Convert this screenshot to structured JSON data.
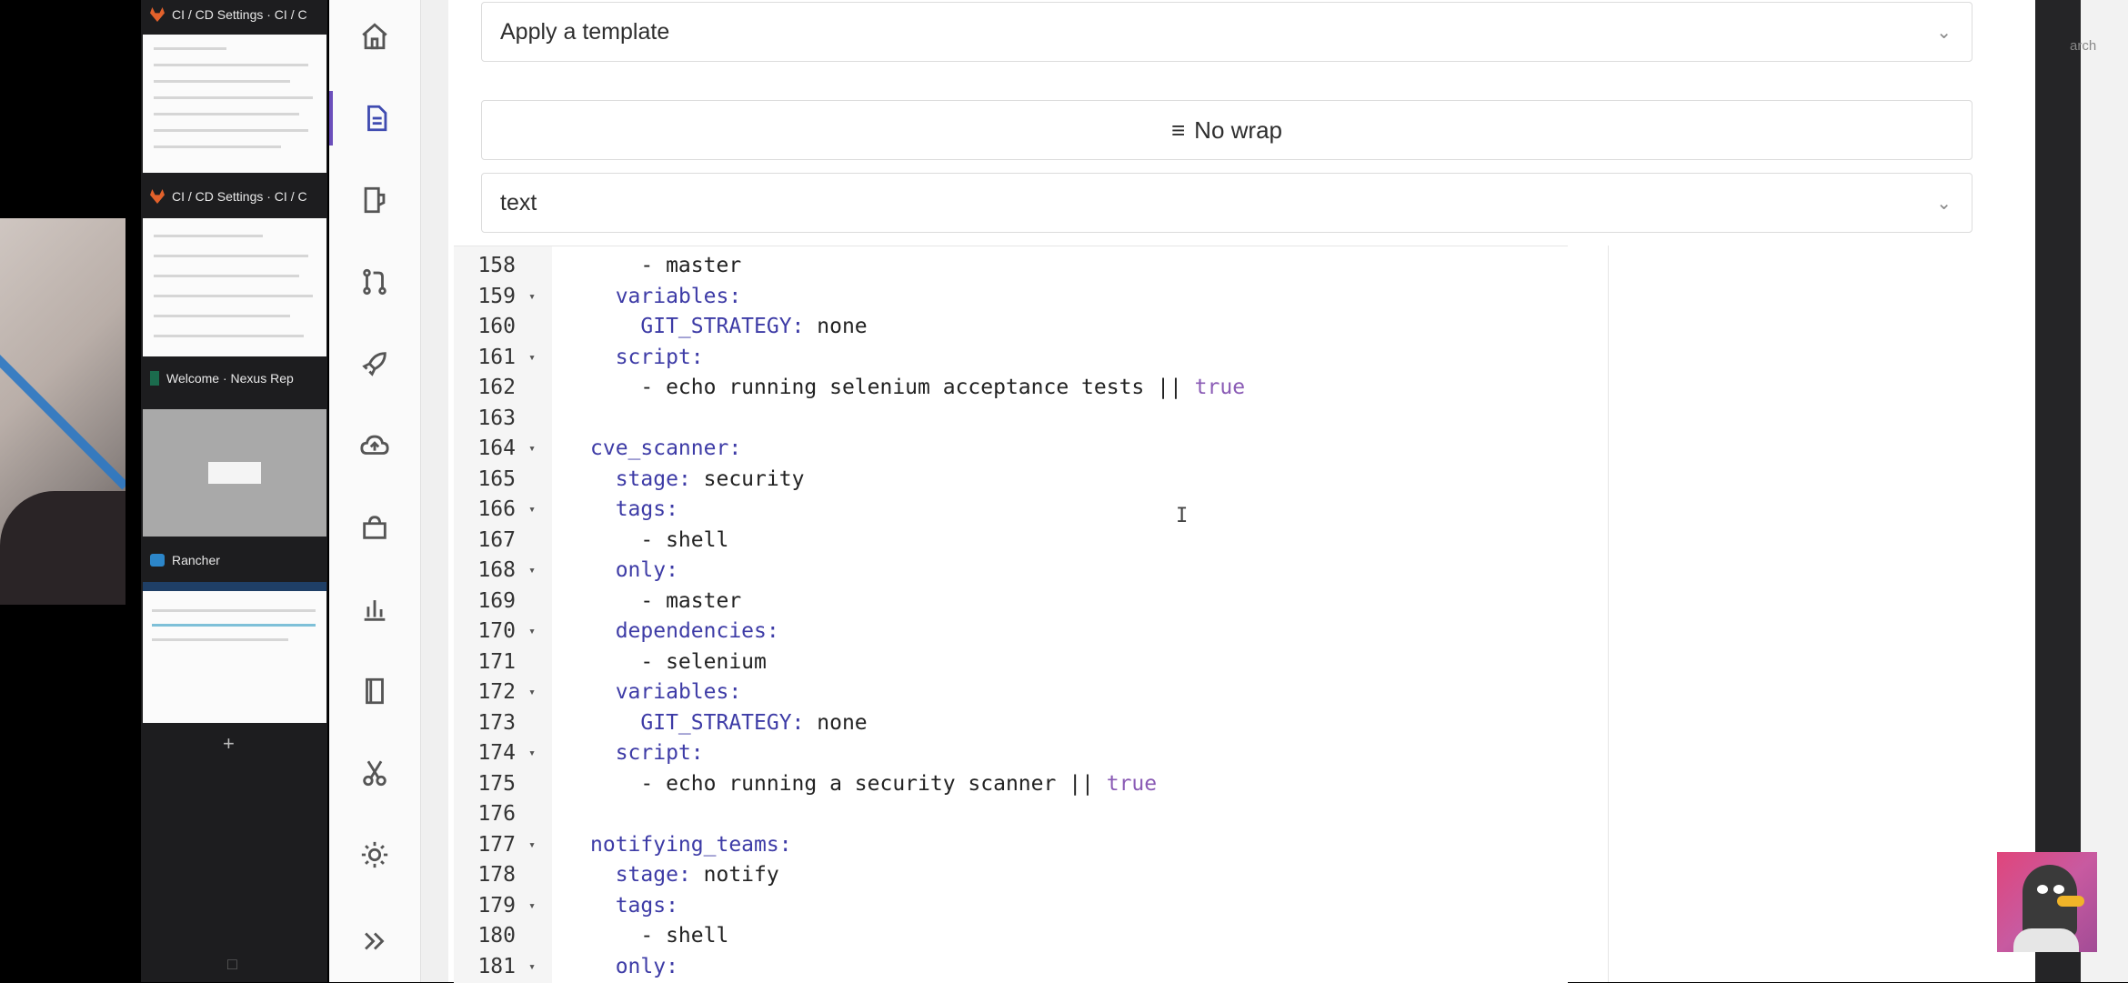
{
  "switcher": {
    "windows": [
      {
        "title": "CI / CD Settings · CI / C",
        "icon": "gitlab-icon"
      },
      {
        "title": "CI / CD Settings · CI / C",
        "icon": "gitlab-icon"
      },
      {
        "title": "Welcome · Nexus Rep",
        "icon": "nexus-icon"
      },
      {
        "title": "Rancher",
        "icon": "rancher-icon"
      }
    ],
    "add_label": "+"
  },
  "sidebar": {
    "items": [
      {
        "name": "home-icon"
      },
      {
        "name": "file-icon",
        "active": true
      },
      {
        "name": "issues-icon"
      },
      {
        "name": "merge-request-icon"
      },
      {
        "name": "rocket-icon"
      },
      {
        "name": "cloud-icon"
      },
      {
        "name": "package-icon"
      },
      {
        "name": "chart-icon"
      },
      {
        "name": "book-icon"
      },
      {
        "name": "scissors-icon"
      },
      {
        "name": "gear-icon"
      },
      {
        "name": "expand-icon"
      }
    ]
  },
  "toolbar": {
    "template_label": "Apply a template",
    "wrap_label": "No wrap",
    "mode_label": "text"
  },
  "editor": {
    "lines": [
      {
        "n": "158",
        "fold": false,
        "text": "    - master"
      },
      {
        "n": "159",
        "fold": true,
        "text": "  variables:"
      },
      {
        "n": "160",
        "fold": false,
        "text": "    GIT_STRATEGY: none"
      },
      {
        "n": "161",
        "fold": true,
        "text": "  script:"
      },
      {
        "n": "162",
        "fold": false,
        "text": "    - echo running selenium acceptance tests || true"
      },
      {
        "n": "163",
        "fold": false,
        "text": ""
      },
      {
        "n": "164",
        "fold": true,
        "text": "cve_scanner:"
      },
      {
        "n": "165",
        "fold": false,
        "text": "  stage: security"
      },
      {
        "n": "166",
        "fold": true,
        "text": "  tags:"
      },
      {
        "n": "167",
        "fold": false,
        "text": "    - shell"
      },
      {
        "n": "168",
        "fold": true,
        "text": "  only:"
      },
      {
        "n": "169",
        "fold": false,
        "text": "    - master"
      },
      {
        "n": "170",
        "fold": true,
        "text": "  dependencies:"
      },
      {
        "n": "171",
        "fold": false,
        "text": "    - selenium"
      },
      {
        "n": "172",
        "fold": true,
        "text": "  variables:"
      },
      {
        "n": "173",
        "fold": false,
        "text": "    GIT_STRATEGY: none"
      },
      {
        "n": "174",
        "fold": true,
        "text": "  script:"
      },
      {
        "n": "175",
        "fold": false,
        "text": "    - echo running a security scanner || true"
      },
      {
        "n": "176",
        "fold": false,
        "text": ""
      },
      {
        "n": "177",
        "fold": true,
        "text": "notifying_teams:"
      },
      {
        "n": "178",
        "fold": false,
        "text": "  stage: notify"
      },
      {
        "n": "179",
        "fold": true,
        "text": "  tags:"
      },
      {
        "n": "180",
        "fold": false,
        "text": "    - shell"
      },
      {
        "n": "181",
        "fold": true,
        "text": "  only:"
      }
    ],
    "cursor_glyph": "I"
  },
  "right_edge": {
    "search_text": "arch"
  },
  "colors": {
    "accent": "#6b4fbb",
    "key": "#3d3ba6",
    "keyword": "#8a5bb5"
  }
}
